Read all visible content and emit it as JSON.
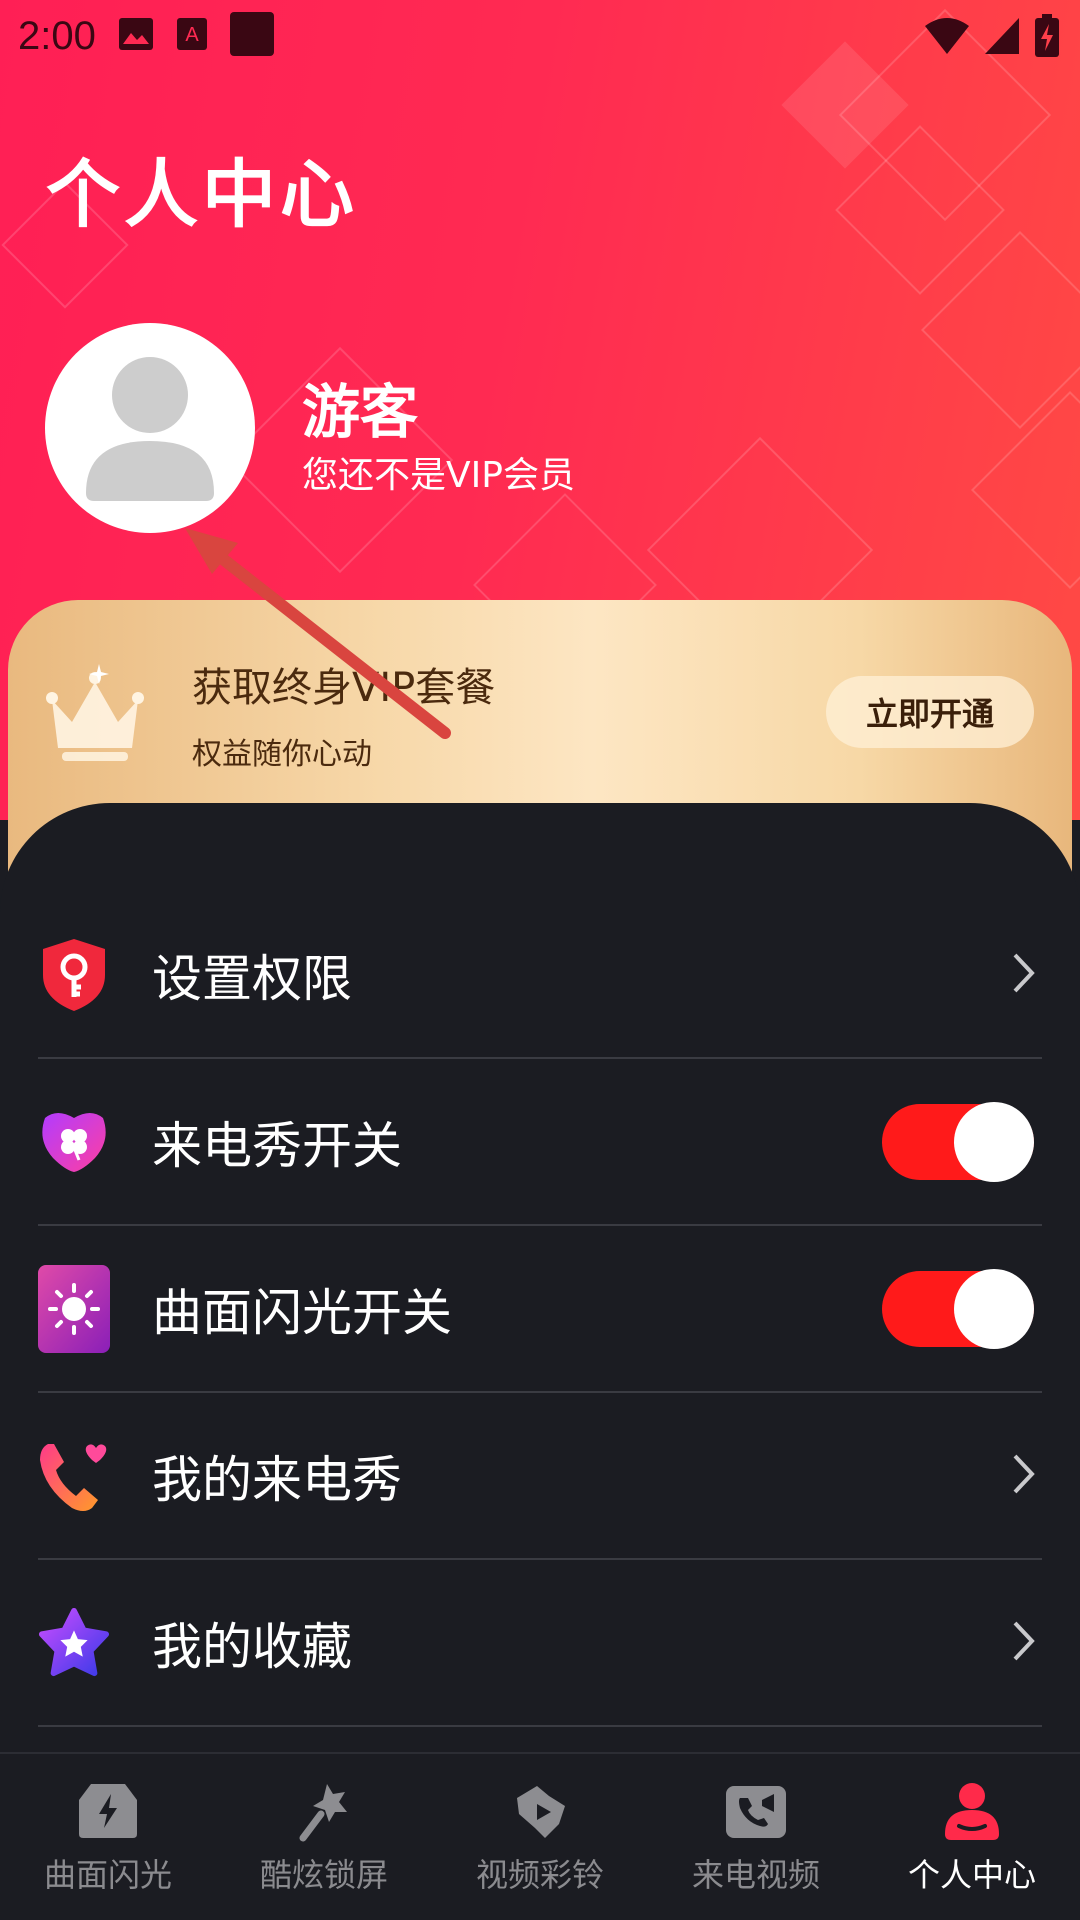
{
  "status_bar": {
    "time": "2:00",
    "left_icons": [
      "image-icon",
      "font-icon",
      "square-icon"
    ],
    "right_icons": [
      "wifi-icon",
      "signal-icon",
      "battery-charging-icon"
    ]
  },
  "header": {
    "title": "个人中心",
    "user": {
      "name": "游客",
      "subtitle": "您还不是VIP会员"
    }
  },
  "vip": {
    "title": "获取终身VIP套餐",
    "subtitle": "权益随你心动",
    "button": "立即开通"
  },
  "menu": [
    {
      "label": "设置权限",
      "icon": "shield-key-icon",
      "control": "chevron"
    },
    {
      "label": "来电秀开关",
      "icon": "clover-icon",
      "control": "toggle",
      "enabled": true
    },
    {
      "label": "曲面闪光开关",
      "icon": "sun-icon",
      "control": "toggle",
      "enabled": true
    },
    {
      "label": "我的来电秀",
      "icon": "phone-heart-icon",
      "control": "chevron"
    },
    {
      "label": "我的收藏",
      "icon": "star-icon",
      "control": "chevron"
    }
  ],
  "tabs": [
    {
      "label": "曲面闪光",
      "icon": "flash-icon",
      "active": false
    },
    {
      "label": "酷炫锁屏",
      "icon": "magic-wand-icon",
      "active": false
    },
    {
      "label": "视频彩铃",
      "icon": "video-bell-icon",
      "active": false
    },
    {
      "label": "来电视频",
      "icon": "video-call-icon",
      "active": false
    },
    {
      "label": "个人中心",
      "icon": "person-icon",
      "active": true
    }
  ],
  "colors": {
    "header_red": "#ff2a52",
    "panel_dark": "#1b1c22",
    "toggle_on": "#ff1a1a",
    "vip_gold": "#f7d8a9",
    "annotation_arrow": "#d9453f"
  }
}
